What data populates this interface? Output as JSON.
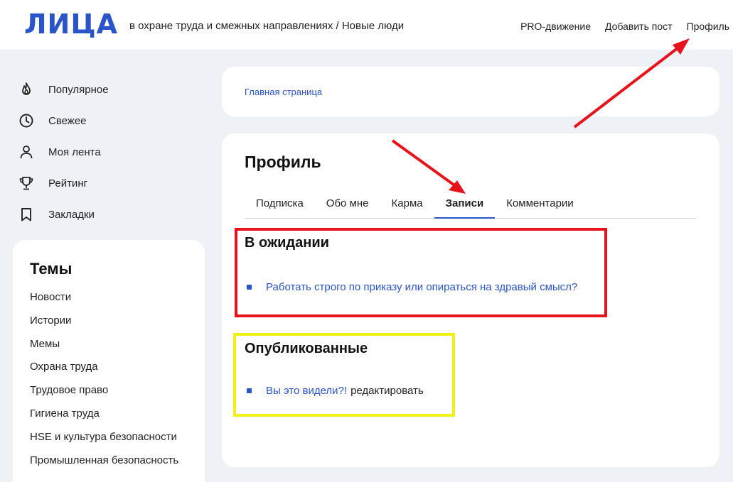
{
  "header": {
    "logo": "ЛИЦА",
    "tagline": "в охране труда и смежных направлениях / Новые люди",
    "nav": [
      {
        "label": "PRO-движение"
      },
      {
        "label": "Добавить пост"
      },
      {
        "label": "Профиль"
      }
    ]
  },
  "sidebar": {
    "items": [
      {
        "label": "Популярное",
        "icon": "flame-icon"
      },
      {
        "label": "Свежее",
        "icon": "clock-icon"
      },
      {
        "label": "Моя лента",
        "icon": "user-icon"
      },
      {
        "label": "Рейтинг",
        "icon": "trophy-icon"
      },
      {
        "label": "Закладки",
        "icon": "bookmark-icon"
      }
    ]
  },
  "topics": {
    "title": "Темы",
    "items": [
      "Новости",
      "Истории",
      "Мемы",
      "Охрана труда",
      "Трудовое право",
      "Гигиена труда",
      "HSE и культура безопасности",
      "Промышленная безопасность"
    ]
  },
  "breadcrumb": {
    "label": "Главная страница"
  },
  "profile": {
    "title": "Профиль",
    "tabs": [
      {
        "label": "Подписка",
        "active": false
      },
      {
        "label": "Обо мне",
        "active": false
      },
      {
        "label": "Карма",
        "active": false
      },
      {
        "label": "Записи",
        "active": true
      },
      {
        "label": "Комментарии",
        "active": false
      }
    ],
    "pending": {
      "title": "В ожидании",
      "post": "Работать строго по приказу или опираться на здравый смысл?"
    },
    "published": {
      "title": "Опубликованные",
      "post": "Вы это видели?!",
      "edit": "редактировать"
    }
  },
  "colors": {
    "accent": "#2a55c9",
    "background": "#eef1f6",
    "annotation_red": "#e8121a",
    "annotation_yellow": "#f2ef12"
  }
}
